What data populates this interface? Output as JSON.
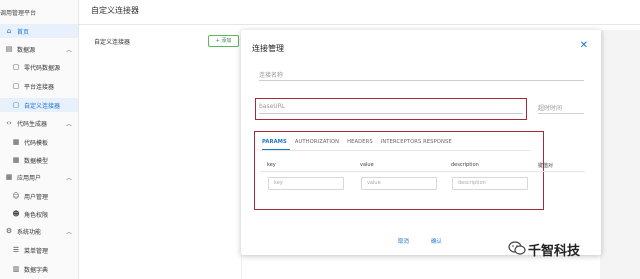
{
  "app": {
    "brand": "调用管理平台"
  },
  "sidebar": {
    "home": "首页",
    "groups": [
      {
        "label": "数据源",
        "items": [
          "零代码数据源",
          "平台连接器",
          "自定义连接器"
        ]
      },
      {
        "label": "代码生成器",
        "items": [
          "代码模板",
          "数据模型"
        ]
      },
      {
        "label": "应用用户",
        "items": [
          "用户管理",
          "角色权限"
        ]
      },
      {
        "label": "系统功能",
        "items": [
          "菜单管理",
          "数据字典"
        ]
      }
    ]
  },
  "header": {
    "title": "自定义连接器"
  },
  "list_panel": {
    "label": "自定义连接器",
    "add_button": "+ 添加"
  },
  "dialog": {
    "title": "连接管理",
    "close": "✕",
    "fields": {
      "name_placeholder": "连接名称",
      "base_url_placeholder": "baseURL",
      "timeout_placeholder": "超时时间"
    },
    "tabs": [
      "PARAMS",
      "AUTHORIZATION",
      "HEADERS",
      "INTERCEPTORS RESPONSE"
    ],
    "active_tab": "PARAMS",
    "table": {
      "headers": [
        "key",
        "value",
        "description",
        "键值对"
      ],
      "row_placeholders": [
        "key",
        "value",
        "description"
      ]
    },
    "buttons": {
      "cancel": "取消",
      "ok": "确认"
    }
  },
  "watermark": {
    "text": "千智科技"
  },
  "colors": {
    "accent": "#1976d2",
    "highlight_box": "#a32b3a",
    "add_button_border": "#5cb85c"
  }
}
